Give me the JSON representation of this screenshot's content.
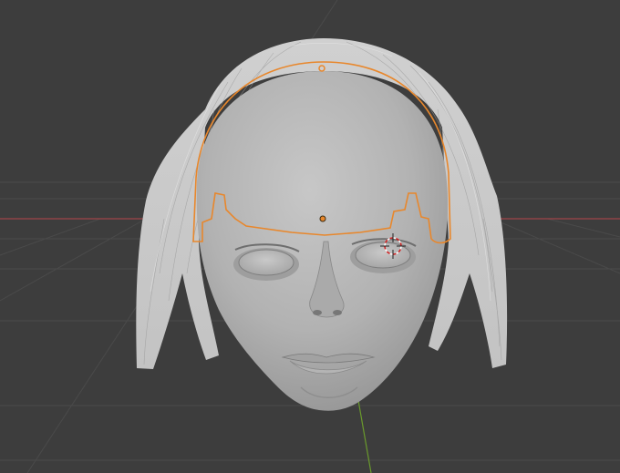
{
  "app": {
    "name": "3D Viewport",
    "view": "perspective"
  },
  "scene": {
    "object": "head-sculpt",
    "hair": "hair-particles",
    "selection_outline_color": "#e8872c",
    "origin_color": "#e8872c",
    "x_axis_color": "#a04448",
    "y_axis_color": "#6a9a2c",
    "grid_color": "#4a4a4a",
    "background_color": "#3d3d3d",
    "mesh_color": "#b9b9b9",
    "hair_color": "#d2d2d2"
  },
  "icons": {
    "cursor": "3d-cursor-icon",
    "origin": "object-origin-icon"
  }
}
